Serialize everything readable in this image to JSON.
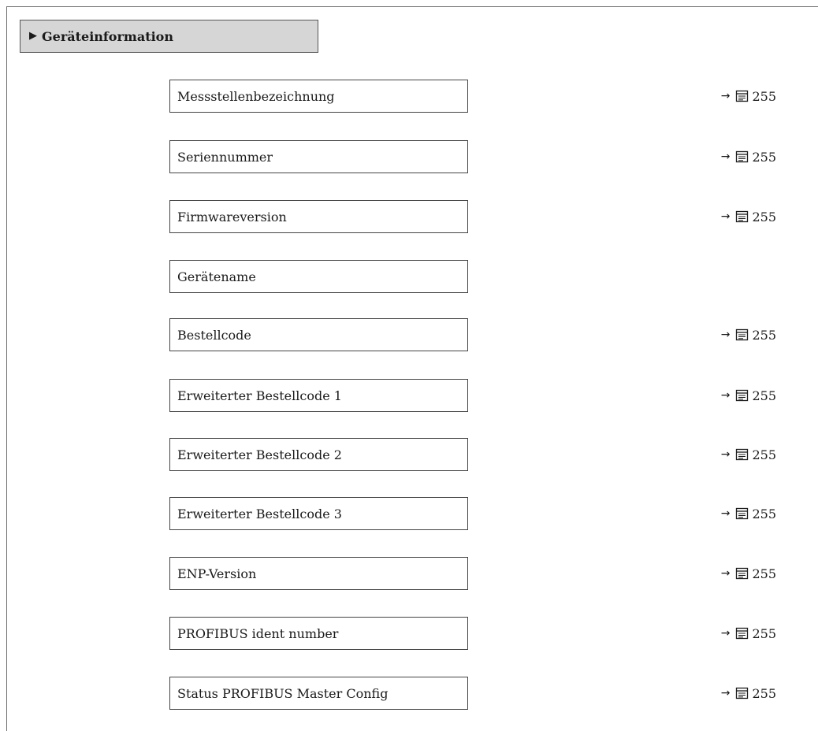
{
  "section": {
    "title": "Geräteinformation"
  },
  "parameters": [
    {
      "label": "Messstellenbezeichnung",
      "ref_arrow": "→",
      "page": "255"
    },
    {
      "label": "Seriennummer",
      "ref_arrow": "→",
      "page": "255"
    },
    {
      "label": "Firmwareversion",
      "ref_arrow": "→",
      "page": "255"
    },
    {
      "label": "Gerätename",
      "ref_arrow": "",
      "page": ""
    },
    {
      "label": "Bestellcode",
      "ref_arrow": "→",
      "page": "255"
    },
    {
      "label": "Erweiterter Bestellcode 1",
      "ref_arrow": "→",
      "page": "255"
    },
    {
      "label": "Erweiterter Bestellcode 2",
      "ref_arrow": "→",
      "page": "255"
    },
    {
      "label": "Erweiterter Bestellcode 3",
      "ref_arrow": "→",
      "page": "255"
    },
    {
      "label": "ENP-Version",
      "ref_arrow": "→",
      "page": "255"
    },
    {
      "label": "PROFIBUS ident number",
      "ref_arrow": "→",
      "page": "255"
    },
    {
      "label": "Status PROFIBUS Master Config",
      "ref_arrow": "→",
      "page": "255"
    }
  ],
  "icons": {
    "section_marker": "triangle-right-icon",
    "page_reference": "book-page-icon"
  },
  "colors": {
    "header_background": "#d6d6d6",
    "border": "#444444"
  }
}
